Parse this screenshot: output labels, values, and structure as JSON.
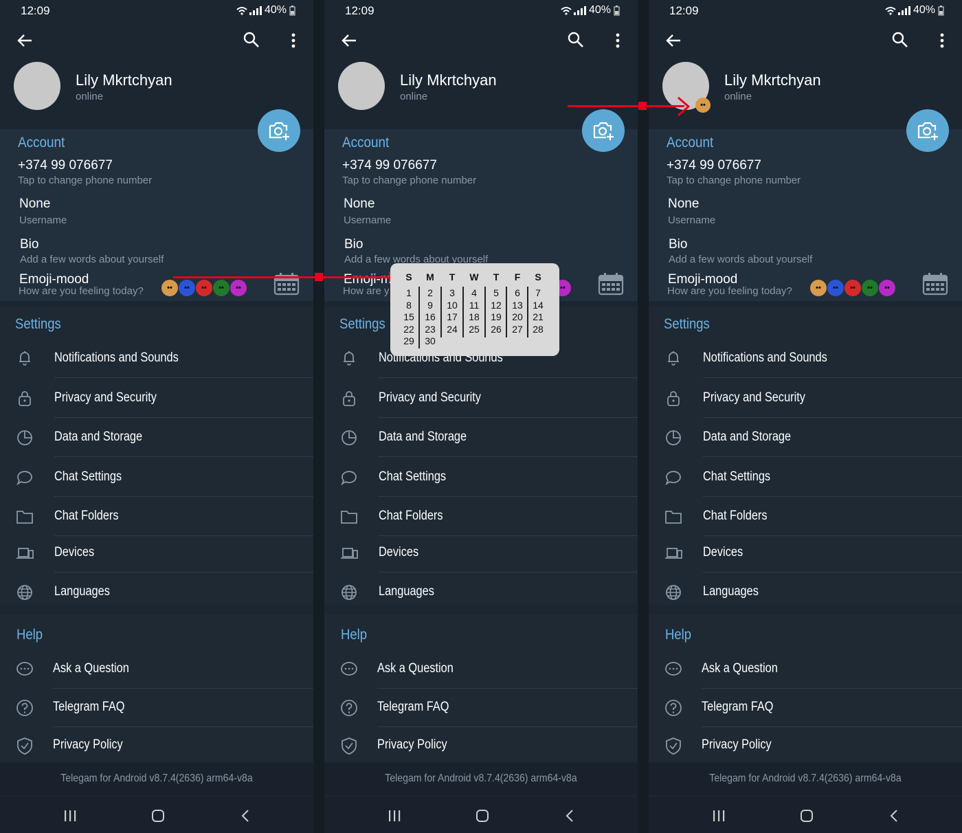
{
  "status": {
    "time": "12:09",
    "battery": "40%"
  },
  "profile": {
    "name": "Lily Mkrtchyan",
    "status": "online"
  },
  "account": {
    "section_title": "Account",
    "phone": "+374 99 076677",
    "phone_hint": "Tap to change phone number",
    "username": "None",
    "username_hint": "Username",
    "bio": "Bio",
    "bio_hint": "Add a few words about yourself",
    "emoji_mood": "Emoji-mood",
    "emoji_mood_hint": "How are you feeling today?",
    "emoji_mood_partial": "Emoji-m",
    "emoji_mood_hint_partial": "How are y"
  },
  "emojis": [
    {
      "name": "happy",
      "color": "#d99a4a"
    },
    {
      "name": "sad",
      "color": "#2a55d6"
    },
    {
      "name": "angry",
      "color": "#d62a2a"
    },
    {
      "name": "sick",
      "color": "#1f7a2a"
    },
    {
      "name": "love",
      "color": "#b82ac4"
    }
  ],
  "settings": {
    "section_title": "Settings",
    "items": [
      {
        "label": "Notifications and Sounds",
        "icon": "bell-icon"
      },
      {
        "label": "Privacy and Security",
        "icon": "lock-icon"
      },
      {
        "label": "Data and Storage",
        "icon": "pie-chart-icon"
      },
      {
        "label": "Chat Settings",
        "icon": "chat-bubble-icon"
      },
      {
        "label": "Chat Folders",
        "icon": "folder-icon"
      },
      {
        "label": "Devices",
        "icon": "devices-icon"
      },
      {
        "label": "Languages",
        "icon": "globe-icon"
      }
    ]
  },
  "help": {
    "section_title": "Help",
    "items": [
      {
        "label": "Ask a Question",
        "icon": "chat-dots-icon"
      },
      {
        "label": "Telegram FAQ",
        "icon": "question-icon"
      },
      {
        "label": "Privacy Policy",
        "icon": "shield-icon"
      }
    ]
  },
  "footer": "Telegam for Android v8.7.4(2636) arm64-v8a",
  "calendar": {
    "headers": [
      "S",
      "M",
      "T",
      "W",
      "T",
      "F",
      "S"
    ],
    "weeks": [
      [
        "1",
        "2",
        "3",
        "4",
        "5",
        "6",
        "7"
      ],
      [
        "8",
        "9",
        "10",
        "11",
        "12",
        "13",
        "14"
      ],
      [
        "15",
        "16",
        "17",
        "18",
        "19",
        "20",
        "21"
      ],
      [
        "22",
        "23",
        "24",
        "25",
        "26",
        "27",
        "28"
      ],
      [
        "29",
        "30"
      ]
    ]
  },
  "colors": {
    "accent": "#5ba8d4",
    "section": "#6cb3e4",
    "annotation": "#e8001c",
    "background": "#1c2631"
  }
}
